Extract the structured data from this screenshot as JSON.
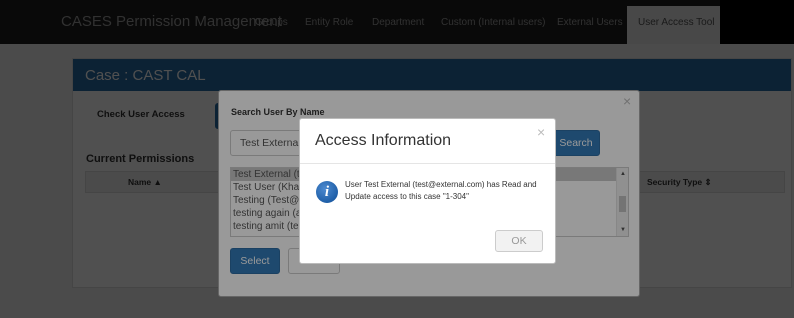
{
  "app": {
    "brand": "CASES Permission Management",
    "nav": [
      "Groups",
      "Entity Role",
      "Department",
      "Custom (Internal users)",
      "External Users",
      "User Access Tool"
    ],
    "active_nav": "User Access Tool"
  },
  "case": {
    "title": "Case  :  CAST CAL",
    "tab_check_user_access": "Check User Access",
    "current_permissions": "Current Permissions",
    "columns": {
      "name": "Name ▲",
      "security_type": "Security Type ⇕"
    }
  },
  "search_modal": {
    "close_glyph": "×",
    "title": "Search User By Name",
    "input_value": "Test External",
    "search_label": "Search",
    "users": [
      "Test External (test@external.com)",
      "Test User (Khan)",
      "Testing (Test@",
      "testing again (a",
      "testing amit (te"
    ],
    "selected_index": 0,
    "select_label": "Select",
    "close_label": "Close"
  },
  "access_modal": {
    "title": "Access Information",
    "close_glyph": "×",
    "icon": "info-icon",
    "icon_glyph": "i",
    "message": "User Test External (test@external.com) has Read and Update access to this case \"1-304\"",
    "ok_label": "OK"
  },
  "colors": {
    "navbar": "#1e1e1e",
    "case_header": "#2a6ea8",
    "primary_button": "#337ab7",
    "active_tab": "#e7e7e7"
  }
}
